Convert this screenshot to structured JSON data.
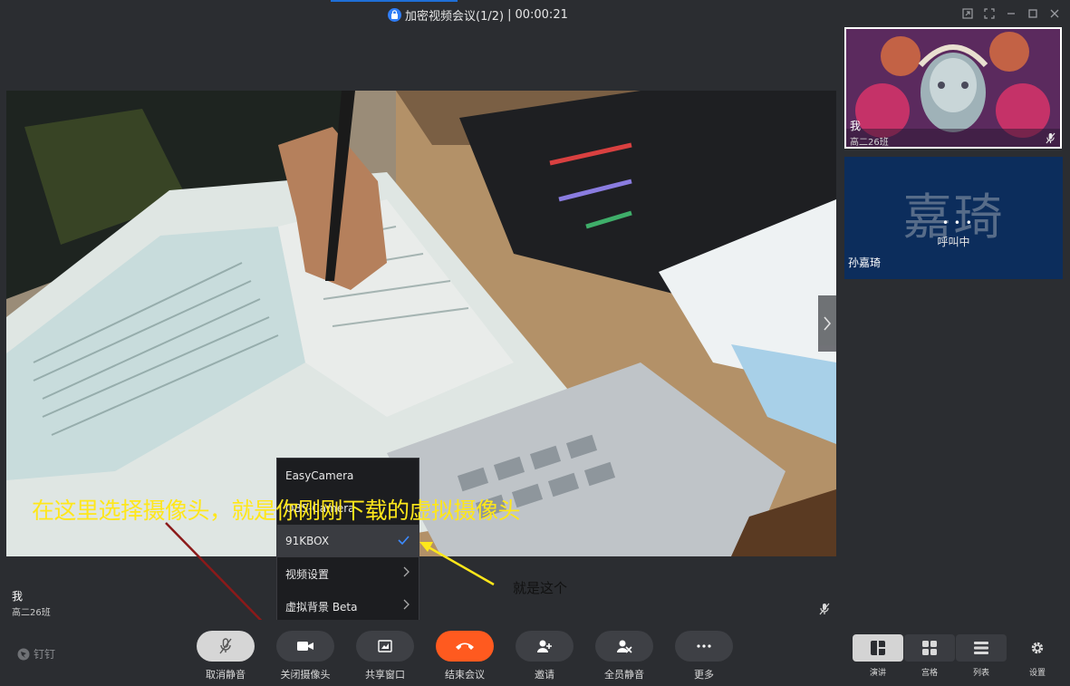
{
  "window": {
    "title": "加密视频会议(1/2)",
    "separator": "|",
    "timer": "00:00:21"
  },
  "main_video": {
    "name": "我",
    "subtitle": "高二26班"
  },
  "participants": [
    {
      "name": "我",
      "subtitle": "高二26班"
    },
    {
      "name": "孙嘉琦",
      "avatar_text": "嘉琦",
      "status_dots": "• • •",
      "status": "呼叫中"
    }
  ],
  "camera_menu": {
    "items": [
      {
        "label": "EasyCamera"
      },
      {
        "label": "OBS-Camera"
      },
      {
        "label": "91KBOX",
        "selected": true
      },
      {
        "label": "视频设置"
      },
      {
        "label": "虚拟背景 Beta"
      }
    ]
  },
  "annotations": {
    "main_text": "在这里选择摄像头，就是你刚刚下载的虚拟摄像头",
    "pointer_text": "就是这个"
  },
  "brand": {
    "label": "钉钉"
  },
  "controls": [
    {
      "label": "取消静音",
      "icon": "mic-off-icon"
    },
    {
      "label": "关闭摄像头",
      "icon": "camera-icon"
    },
    {
      "label": "共享窗口",
      "icon": "share-screen-icon"
    },
    {
      "label": "结束会议",
      "icon": "hangup-icon"
    },
    {
      "label": "邀请",
      "icon": "add-user-icon"
    },
    {
      "label": "全员静音",
      "icon": "mute-all-icon"
    },
    {
      "label": "更多",
      "icon": "more-icon"
    }
  ],
  "layouts": [
    {
      "label": "演讲",
      "icon": "speaker-layout-icon",
      "active": true
    },
    {
      "label": "宫格",
      "icon": "grid-layout-icon"
    },
    {
      "label": "列表",
      "icon": "list-layout-icon"
    }
  ],
  "settings": {
    "label": "设置",
    "icon": "gear-icon"
  },
  "colors": {
    "background": "#2b2d31",
    "accent": "#1f6fd6",
    "end_call": "#ff5a1f",
    "annotation_yellow": "#ffe71a",
    "annotation_red": "#8b1a1a",
    "call_tile": "#0c2d5c"
  }
}
